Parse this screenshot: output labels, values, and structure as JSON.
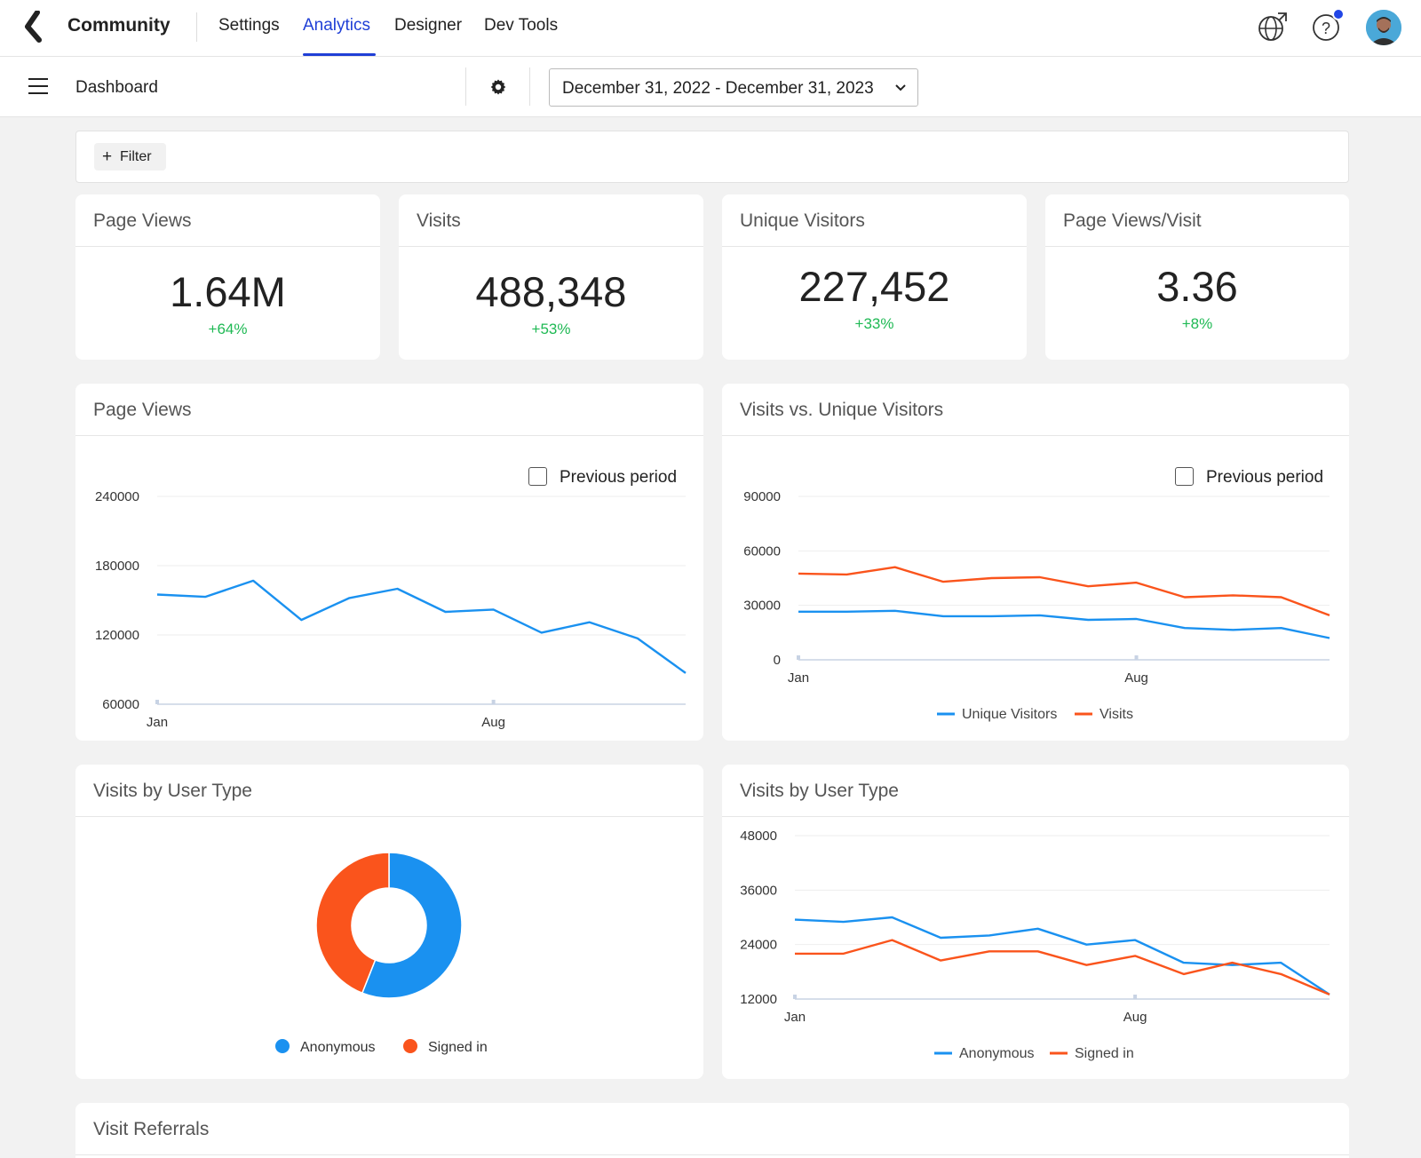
{
  "nav": {
    "brand": "Community",
    "tabs": [
      {
        "label": "Settings",
        "active": false
      },
      {
        "label": "Analytics",
        "active": true
      },
      {
        "label": "Designer",
        "active": false
      },
      {
        "label": "Dev Tools",
        "active": false
      }
    ],
    "icons": [
      "globe-icon",
      "help-icon",
      "avatar"
    ],
    "accent_color": "#1f3fd6"
  },
  "subbar": {
    "title": "Dashboard",
    "date_range": "December 31, 2022 - December 31, 2023"
  },
  "filter": {
    "button_label": "Filter"
  },
  "kpis": [
    {
      "title": "Page Views",
      "value": "1.64M",
      "delta": "+64%"
    },
    {
      "title": "Visits",
      "value": "488,348",
      "delta": "+53%"
    },
    {
      "title": "Unique Visitors",
      "value": "227,452",
      "delta": "+33%"
    },
    {
      "title": "Page Views/Visit",
      "value": "3.36",
      "delta": "+8%"
    }
  ],
  "panels": {
    "page_views": {
      "title": "Page Views",
      "previous_period_label": "Previous period"
    },
    "visits_vs_unique": {
      "title": "Visits vs. Unique Visitors",
      "previous_period_label": "Previous period"
    },
    "user_type_donut": {
      "title": "Visits by User Type"
    },
    "user_type_line": {
      "title": "Visits by User Type"
    },
    "referrals": {
      "title": "Visit Referrals"
    }
  },
  "colors": {
    "blue": "#1a91f0",
    "orange": "#fa541c",
    "positive": "#1fb954"
  },
  "chart_data": [
    {
      "id": "page_views",
      "type": "line",
      "x_ticks": [
        "Jan",
        "Aug"
      ],
      "x_tick_index": [
        0,
        7
      ],
      "ylim": [
        60000,
        240000
      ],
      "y_ticks": [
        "240000",
        "180000",
        "120000",
        "60000"
      ],
      "series": [
        {
          "values": [
            155000,
            153000,
            167000,
            133000,
            152000,
            160000,
            140000,
            142000,
            122000,
            131000,
            117000,
            87000
          ]
        }
      ]
    },
    {
      "id": "visits_vs_unique",
      "type": "line",
      "x_ticks": [
        "Jan",
        "Aug"
      ],
      "x_tick_index": [
        0,
        7
      ],
      "ylim": [
        0,
        90000
      ],
      "y_ticks": [
        "90000",
        "60000",
        "30000",
        "0"
      ],
      "series": [
        {
          "name": "Unique Visitors",
          "values": [
            26500,
            26500,
            27000,
            24000,
            24000,
            24500,
            22000,
            22500,
            17500,
            16500,
            17500,
            12000
          ]
        },
        {
          "name": "Visits",
          "values": [
            47500,
            47000,
            51000,
            43000,
            45000,
            45500,
            40500,
            42500,
            34500,
            35500,
            34500,
            24500
          ]
        }
      ]
    },
    {
      "id": "user_type_donut",
      "type": "pie",
      "series": [
        {
          "name": "Anonymous",
          "value": 56
        },
        {
          "name": "Signed in",
          "value": 44
        }
      ]
    },
    {
      "id": "user_type_line",
      "type": "line",
      "x_ticks": [
        "Jan",
        "Aug"
      ],
      "x_tick_index": [
        0,
        7
      ],
      "ylim": [
        12000,
        48000
      ],
      "y_ticks": [
        "48000",
        "36000",
        "24000",
        "12000"
      ],
      "series": [
        {
          "name": "Anonymous",
          "values": [
            29500,
            29000,
            30000,
            25500,
            26000,
            27500,
            24000,
            25000,
            20000,
            19500,
            20000,
            13000
          ]
        },
        {
          "name": "Signed in",
          "values": [
            22000,
            22000,
            25000,
            20500,
            22500,
            22500,
            19500,
            21500,
            17500,
            20000,
            17500,
            13000
          ]
        }
      ]
    }
  ]
}
